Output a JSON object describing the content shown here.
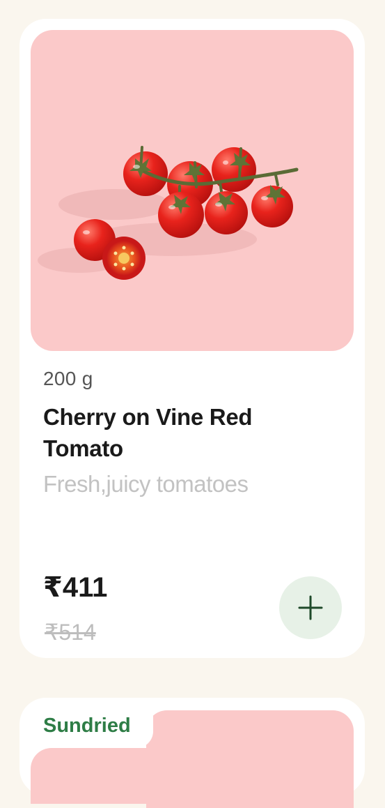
{
  "products": [
    {
      "weight": "200 g",
      "name": "Cherry on Vine Red Tomato",
      "description": "Fresh,juicy tomatoes",
      "price": "₹411",
      "mrp": "₹514",
      "image_icon": "cherry-tomatoes-image",
      "add_icon": "plus-icon"
    },
    {
      "tag": "Sundried"
    }
  ],
  "colors": {
    "page_bg": "#faf6ee",
    "card_bg": "#ffffff",
    "image_bg": "#fbc9c9",
    "add_button_bg": "#e7f1e7",
    "accent_green": "#2e7d46"
  }
}
